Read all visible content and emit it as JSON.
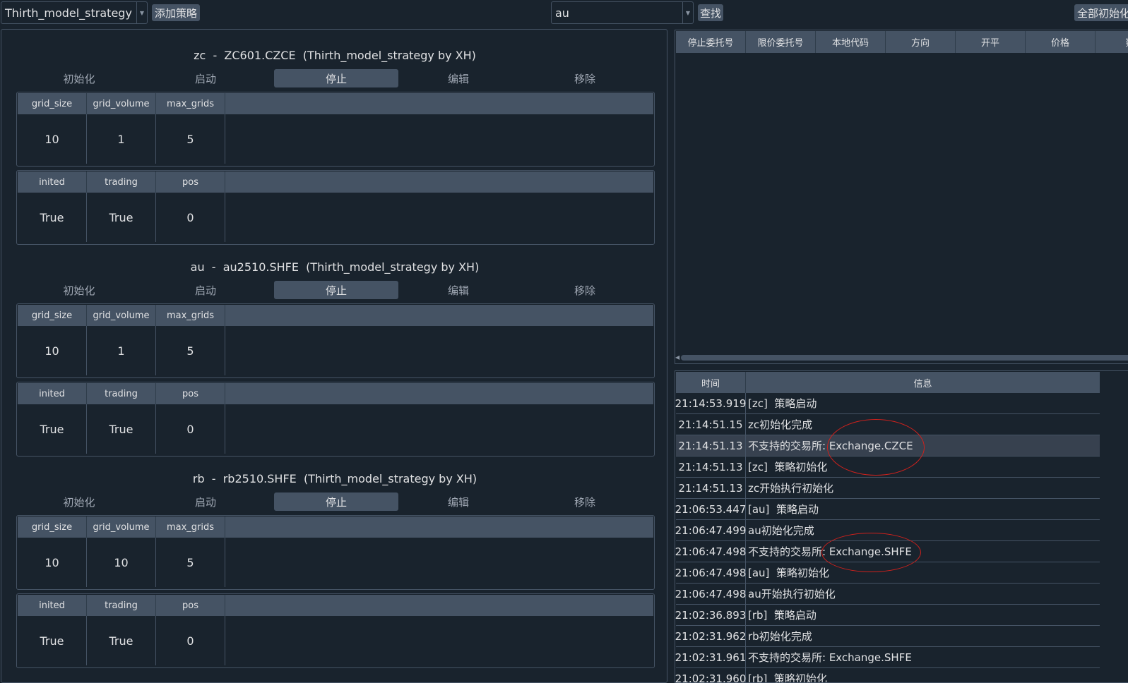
{
  "toolbar": {
    "strategy_select": "Thirth_model_strategy",
    "add_strategy_label": "添加策略",
    "search_value": "au",
    "find_label": "查找",
    "init_all_label": "全部初始化"
  },
  "strategy_actions": [
    "初始化",
    "启动",
    "停止",
    "编辑",
    "移除"
  ],
  "managers": [
    {
      "title": "zc  -  ZC601.CZCE  (Thirth_model_strategy by XH)",
      "params": {
        "headers": [
          "grid_size",
          "grid_volume",
          "max_grids"
        ],
        "values": [
          "10",
          "1",
          "5"
        ]
      },
      "variables": {
        "headers": [
          "inited",
          "trading",
          "pos"
        ],
        "values": [
          "True",
          "True",
          "0"
        ]
      }
    },
    {
      "title": "au  -  au2510.SHFE  (Thirth_model_strategy by XH)",
      "params": {
        "headers": [
          "grid_size",
          "grid_volume",
          "max_grids"
        ],
        "values": [
          "10",
          "1",
          "5"
        ]
      },
      "variables": {
        "headers": [
          "inited",
          "trading",
          "pos"
        ],
        "values": [
          "True",
          "True",
          "0"
        ]
      }
    },
    {
      "title": "rb  -  rb2510.SHFE  (Thirth_model_strategy by XH)",
      "params": {
        "headers": [
          "grid_size",
          "grid_volume",
          "max_grids"
        ],
        "values": [
          "10",
          "10",
          "5"
        ]
      },
      "variables": {
        "headers": [
          "inited",
          "trading",
          "pos"
        ],
        "values": [
          "True",
          "True",
          "0"
        ]
      }
    }
  ],
  "order_table": {
    "headers": [
      "停止委托号",
      "限价委托号",
      "本地代码",
      "方向",
      "开平",
      "价格",
      "数"
    ]
  },
  "log_table": {
    "headers": [
      "时间",
      "信息"
    ],
    "rows": [
      {
        "time": "21:14:53.919",
        "msg": "[zc]  策略启动"
      },
      {
        "time": "21:14:51.15",
        "msg": "zc初始化完成"
      },
      {
        "time": "21:14:51.13",
        "msg": "不支持的交易所: Exchange.CZCE"
      },
      {
        "time": "21:14:51.13",
        "msg": "[zc]  策略初始化"
      },
      {
        "time": "21:14:51.13",
        "msg": "zc开始执行初始化"
      },
      {
        "time": "21:06:53.447",
        "msg": "[au]  策略启动"
      },
      {
        "time": "21:06:47.499",
        "msg": "au初始化完成"
      },
      {
        "time": "21:06:47.498",
        "msg": "不支持的交易所: Exchange.SHFE"
      },
      {
        "time": "21:06:47.498",
        "msg": "[au]  策略初始化"
      },
      {
        "time": "21:06:47.498",
        "msg": "au开始执行初始化"
      },
      {
        "time": "21:02:36.893",
        "msg": "[rb]  策略启动"
      },
      {
        "time": "21:02:31.962",
        "msg": "rb初始化完成"
      },
      {
        "time": "21:02:31.961",
        "msg": "不支持的交易所: Exchange.SHFE"
      },
      {
        "time": "21:02:31.960",
        "msg": "[rb]  策略初始化"
      }
    ]
  },
  "colors": {
    "background": "#19232d",
    "header": "#455364",
    "annotation": "#d0211c"
  }
}
